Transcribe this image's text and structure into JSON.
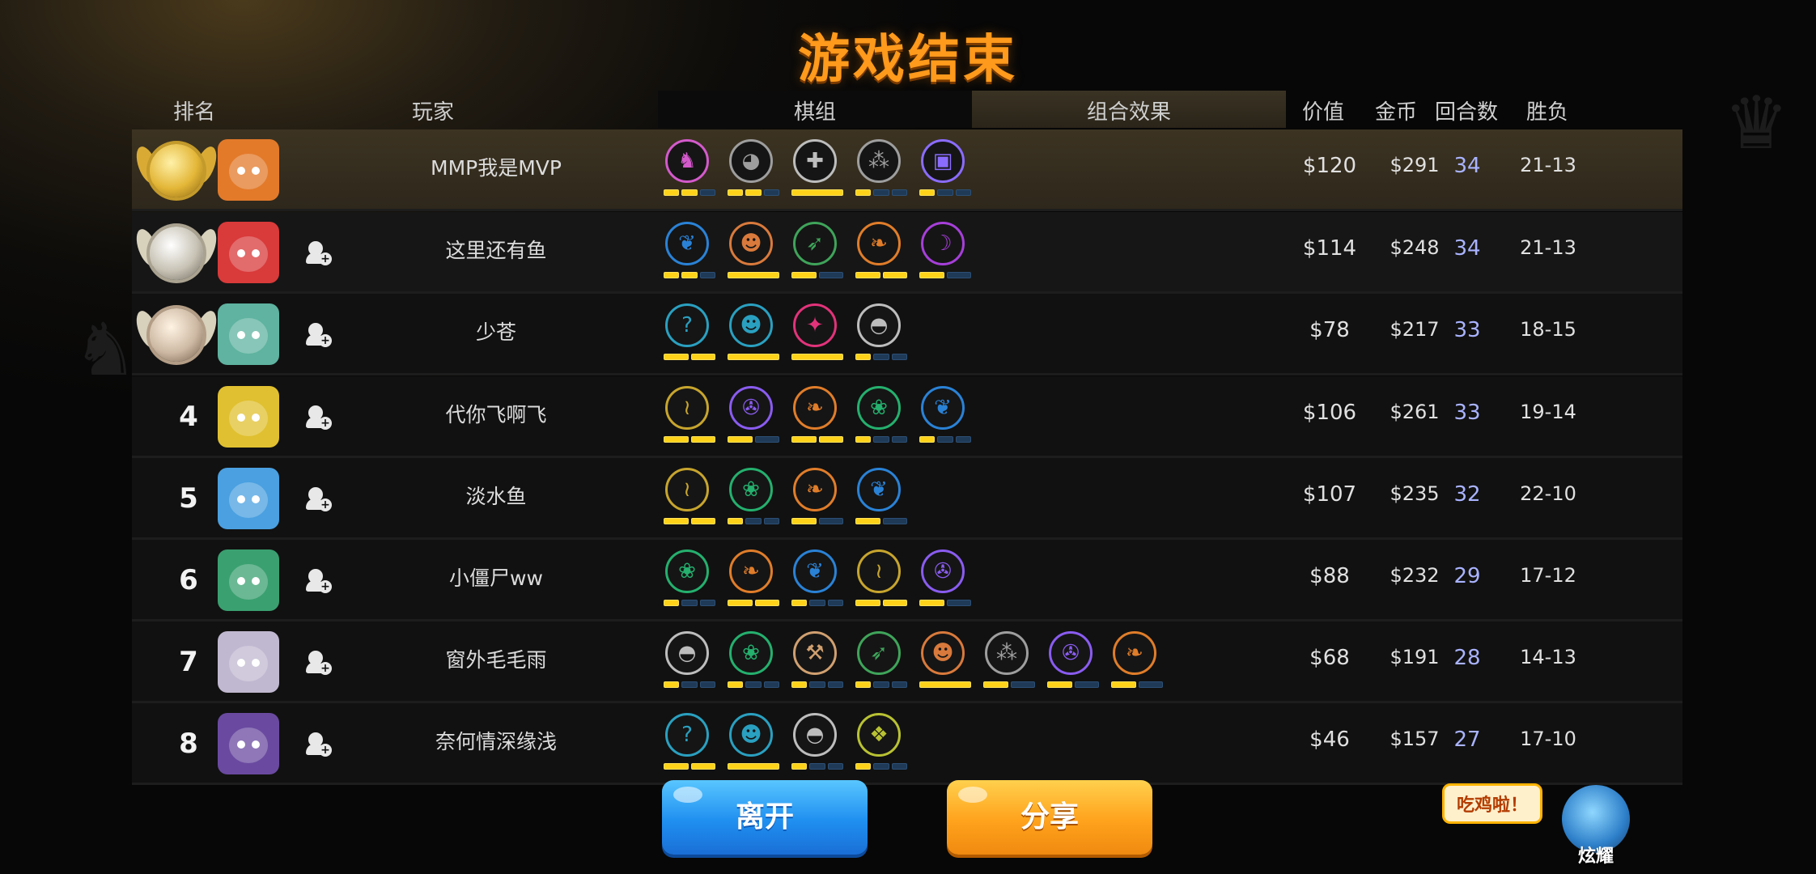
{
  "title": "游戏结束",
  "headers": {
    "rank": "排名",
    "player": "玩家",
    "deck": "棋组",
    "combo": "组合效果",
    "price": "价值",
    "gold": "金币",
    "rounds": "回合数",
    "wl": "胜负"
  },
  "buttons": {
    "leave": "离开",
    "share": "分享"
  },
  "brag": {
    "bubble": "吃鸡啦！",
    "label": "炫耀"
  },
  "colors": {
    "title": "#ff9a1c",
    "bar_on": "#ffd21a",
    "rounds": "#a9b3ff"
  },
  "rows": [
    {
      "rank": "1",
      "medal": "gold",
      "name": "MMP我是MVP",
      "price": "$120",
      "gold": "$291",
      "rounds": "34",
      "wl": "21-13",
      "syn": [
        {
          "icon": "knight-icon",
          "color": "#d35acb",
          "bars": [
            1,
            1,
            0
          ]
        },
        {
          "icon": "penguin-icon",
          "color": "#9e9e9e",
          "bars": [
            1,
            1,
            0
          ]
        },
        {
          "icon": "cross-icon",
          "color": "#bdbdbd",
          "bars": [
            1
          ]
        },
        {
          "icon": "paws-icon",
          "color": "#9e9e9e",
          "bars": [
            1,
            0,
            0
          ]
        },
        {
          "icon": "robot-icon",
          "color": "#8a6cff",
          "bars": [
            1,
            0,
            0
          ]
        }
      ]
    },
    {
      "rank": "2",
      "medal": "silver",
      "name": "这里还有鱼",
      "price": "$114",
      "gold": "$248",
      "rounds": "34",
      "wl": "21-13",
      "syn": [
        {
          "icon": "feather-icon",
          "color": "#2a82d6",
          "bars": [
            1,
            1,
            0
          ]
        },
        {
          "icon": "beast-icon",
          "color": "#d97a3c",
          "bars": [
            1
          ]
        },
        {
          "icon": "bow-icon",
          "color": "#3fa45a",
          "bars": [
            1,
            0
          ]
        },
        {
          "icon": "leaf-icon",
          "color": "#e07d2a",
          "bars": [
            1,
            1
          ]
        },
        {
          "icon": "demon-icon",
          "color": "#a63fd9",
          "bars": [
            1,
            0
          ]
        }
      ]
    },
    {
      "rank": "3",
      "medal": "bronze",
      "name": "少苍",
      "price": "$78",
      "gold": "$217",
      "rounds": "33",
      "wl": "18-15",
      "syn": [
        {
          "icon": "mage-icon",
          "color": "#2aa0c0",
          "bars": [
            1,
            1
          ]
        },
        {
          "icon": "goblin-icon",
          "color": "#2aa0c0",
          "bars": [
            1
          ]
        },
        {
          "icon": "flame-icon",
          "color": "#e2337a",
          "bars": [
            1
          ]
        },
        {
          "icon": "helmet-icon",
          "color": "#bdbdbd",
          "bars": [
            1,
            0,
            0
          ]
        }
      ]
    },
    {
      "rank": "4",
      "medal": "",
      "name": "代你飞啊飞",
      "price": "$106",
      "gold": "$261",
      "rounds": "33",
      "wl": "19-14",
      "syn": [
        {
          "icon": "claw-icon",
          "color": "#c7a52e",
          "bars": [
            1,
            1
          ]
        },
        {
          "icon": "fishbone-icon",
          "color": "#8a5cf0",
          "bars": [
            1,
            0
          ]
        },
        {
          "icon": "leaf-icon",
          "color": "#e07d2a",
          "bars": [
            1,
            1
          ]
        },
        {
          "icon": "paw-icon",
          "color": "#25b06e",
          "bars": [
            1,
            0,
            0
          ]
        },
        {
          "icon": "feather-icon",
          "color": "#2a82d6",
          "bars": [
            1,
            0,
            0
          ]
        }
      ]
    },
    {
      "rank": "5",
      "medal": "",
      "name": "淡水鱼",
      "price": "$107",
      "gold": "$235",
      "rounds": "32",
      "wl": "22-10",
      "syn": [
        {
          "icon": "claw-icon",
          "color": "#c7a52e",
          "bars": [
            1,
            1
          ]
        },
        {
          "icon": "paw-icon",
          "color": "#25b06e",
          "bars": [
            1,
            0,
            0
          ]
        },
        {
          "icon": "leaf-icon",
          "color": "#e07d2a",
          "bars": [
            1,
            0
          ]
        },
        {
          "icon": "feather-icon",
          "color": "#2a82d6",
          "bars": [
            1,
            0
          ]
        }
      ]
    },
    {
      "rank": "6",
      "medal": "",
      "name": "小僵尸ww",
      "price": "$88",
      "gold": "$232",
      "rounds": "29",
      "wl": "17-12",
      "syn": [
        {
          "icon": "paw-icon",
          "color": "#25b06e",
          "bars": [
            1,
            0,
            0
          ]
        },
        {
          "icon": "leaf-icon",
          "color": "#e07d2a",
          "bars": [
            1,
            1
          ]
        },
        {
          "icon": "feather-icon",
          "color": "#2a82d6",
          "bars": [
            1,
            0,
            0
          ]
        },
        {
          "icon": "claw-icon",
          "color": "#c7a52e",
          "bars": [
            1,
            1
          ]
        },
        {
          "icon": "fishbone-icon",
          "color": "#8a5cf0",
          "bars": [
            1,
            0
          ]
        }
      ]
    },
    {
      "rank": "7",
      "medal": "",
      "name": "窗外毛毛雨",
      "price": "$68",
      "gold": "$191",
      "rounds": "28",
      "wl": "14-13",
      "syn": [
        {
          "icon": "helmet-icon",
          "color": "#bdbdbd",
          "bars": [
            1,
            0,
            0
          ]
        },
        {
          "icon": "paw-icon",
          "color": "#25b06e",
          "bars": [
            1,
            0,
            0
          ]
        },
        {
          "icon": "axe-icon",
          "color": "#d0a070",
          "bars": [
            1,
            0,
            0
          ]
        },
        {
          "icon": "bow-icon",
          "color": "#3fa45a",
          "bars": [
            1,
            0,
            0
          ]
        },
        {
          "icon": "beast-icon",
          "color": "#d97a3c",
          "bars": [
            1
          ]
        },
        {
          "icon": "paws-icon",
          "color": "#9e9e9e",
          "bars": [
            1,
            0
          ]
        },
        {
          "icon": "fishbone-icon",
          "color": "#8a5cf0",
          "bars": [
            1,
            0
          ]
        },
        {
          "icon": "leaf-icon",
          "color": "#e07d2a",
          "bars": [
            1,
            0
          ]
        }
      ]
    },
    {
      "rank": "8",
      "medal": "",
      "name": "奈何情深缘浅",
      "price": "$46",
      "gold": "$157",
      "rounds": "27",
      "wl": "17-10",
      "syn": [
        {
          "icon": "mage-icon",
          "color": "#2aa0c0",
          "bars": [
            1,
            1
          ]
        },
        {
          "icon": "goblin-icon",
          "color": "#2aa0c0",
          "bars": [
            1
          ]
        },
        {
          "icon": "helmet-icon",
          "color": "#bdbdbd",
          "bars": [
            1,
            0,
            0
          ]
        },
        {
          "icon": "cube-icon",
          "color": "#b9c233",
          "bars": [
            1,
            0,
            0
          ]
        }
      ]
    }
  ]
}
